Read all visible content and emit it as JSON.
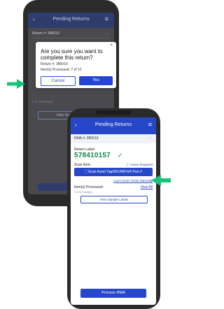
{
  "back_screen": {
    "header_title": "Pending Returns",
    "rma_label": "Return #: 385019",
    "items_processed_bg": "7 of 12 Item(s)",
    "view_sample_labels": "View Sample Labels"
  },
  "dialog": {
    "close_glyph": "×",
    "question": "Are you sure you want to complete this return?",
    "return_line": "Return #: 385019",
    "items_line": "Item(s) Processed: 7 of 12",
    "cancel_label": "Cancel",
    "yes_label": "Yes"
  },
  "front_screen": {
    "header_title": "Pending Returns",
    "rma_label": "RMA #: 385019",
    "return_label_caption": "Return Label:",
    "return_label_number": "578410157",
    "scan_item_label": "Scan Item:",
    "action_required": "Action Required",
    "scan_button": "Scan Asset Tag/SKU/MFGR Part #",
    "manual_link": "Can't Scan? Enter Manually",
    "items_processed_label": "Item(s) Processed:",
    "view_all": "View All",
    "items_count": "7 of 12 Item(s)",
    "view_sample_labels": "View Sample Labels",
    "process_button": "Process RMA"
  },
  "icons": {
    "back": "chevron-left-icon",
    "menu": "hamburger-menu-icon",
    "check": "check-icon",
    "scan": "barcode-scan-icon",
    "action": "info-icon",
    "arrow": "arrow-right-icon"
  },
  "colors": {
    "accent": "#2747c9",
    "success": "#12864a",
    "arrow": "#19c27a"
  }
}
